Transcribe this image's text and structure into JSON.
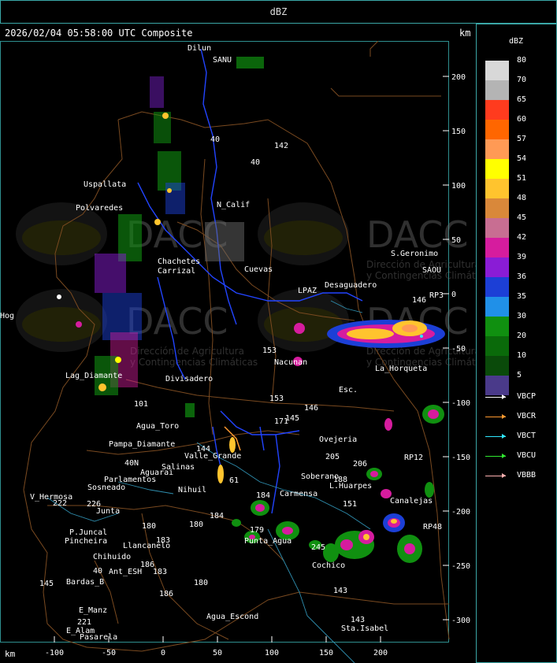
{
  "top_bar": {
    "title": "dBZ"
  },
  "header": {
    "timestamp": "2026/02/04 05:58:00 UTC Composite",
    "unit": "km"
  },
  "bottom": {
    "unit": "km"
  },
  "legend": {
    "title": "dBZ",
    "entries": [
      {
        "label": "80",
        "color": "#d8d8d8"
      },
      {
        "label": "70",
        "color": "#b4b4b4"
      },
      {
        "label": "65",
        "color": "#ff3b1e"
      },
      {
        "label": "60",
        "color": "#ff6600"
      },
      {
        "label": "57",
        "color": "#ff9a55"
      },
      {
        "label": "54",
        "color": "#ffff00"
      },
      {
        "label": "51",
        "color": "#ffc42e"
      },
      {
        "label": "48",
        "color": "#d9883a"
      },
      {
        "label": "45",
        "color": "#c86e92"
      },
      {
        "label": "42",
        "color": "#d61c9e"
      },
      {
        "label": "39",
        "color": "#8a1cd6"
      },
      {
        "label": "36",
        "color": "#1c3fd6"
      },
      {
        "label": "35",
        "color": "#2090e8"
      },
      {
        "label": "30",
        "color": "#109010"
      },
      {
        "label": "20",
        "color": "#0a6a0a"
      },
      {
        "label": "10",
        "color": "#0a4a0a"
      },
      {
        "label": "5",
        "color": "#4a3a8a"
      }
    ]
  },
  "radars": [
    {
      "label": "VBCP",
      "color": "#ffffff"
    },
    {
      "label": "VBCR",
      "color": "#ff9a30"
    },
    {
      "label": "VBCT",
      "color": "#30e8ff"
    },
    {
      "label": "VBCU",
      "color": "#30e830"
    },
    {
      "label": "VBBB",
      "color": "#ffb0b0"
    }
  ],
  "x_axis": [
    "-100",
    "-50",
    "0",
    "50",
    "100",
    "150",
    "200"
  ],
  "y_axis": [
    "200",
    "150",
    "100",
    "50",
    "0",
    "-50",
    "-100",
    "-150",
    "-200",
    "-250",
    "-300"
  ],
  "watermark": {
    "brand": "DACC",
    "line1": "Dirección de Agricultura",
    "line2": "y Contingencias Climáticas"
  },
  "towns": [
    "Dilun",
    "SANU",
    "Uspallata",
    "Polvaredes",
    "N_Calif",
    "Carrizal",
    "Cuevas",
    "Desaguadero",
    "S.Geronimo",
    "SAOU",
    "LPAZ",
    "RP3",
    "146",
    "Nacunan",
    "La_Horqueta",
    "Lag_Diamante",
    "Divisadero",
    "Esc.",
    "Agua_Toro",
    "Pampa_Diamante",
    "Valle_Grande",
    "Salinas",
    "Nihuil",
    "Ovejeria",
    "Soberano",
    "L.Huarpes",
    "Canalejas",
    "Parlamentos",
    "Sosneado",
    "V_Hermosa",
    "Junta",
    "P.Juncal",
    "Pincheira",
    "Chihuido",
    "Llancanelo",
    "Ant_ESH",
    "Bardas_B",
    "E_Manz",
    "E_Alam",
    "Pasarela",
    "Agua_Escond",
    "Punta_Agua",
    "Carmensa",
    "Cochico",
    "Sta.Isabel",
    "Aguarai",
    "Chachetes",
    "RP48",
    "RP12",
    "Hog"
  ],
  "road_numbers": [
    "40",
    "142",
    "40",
    "153",
    "153",
    "145",
    "146",
    "171",
    "205",
    "206",
    "188",
    "151",
    "184",
    "179",
    "180",
    "184",
    "183",
    "145",
    "221",
    "40",
    "186",
    "183",
    "180",
    "226",
    "143",
    "143",
    "245",
    "222",
    "101",
    "144",
    "61",
    "180",
    "186",
    "40N"
  ]
}
